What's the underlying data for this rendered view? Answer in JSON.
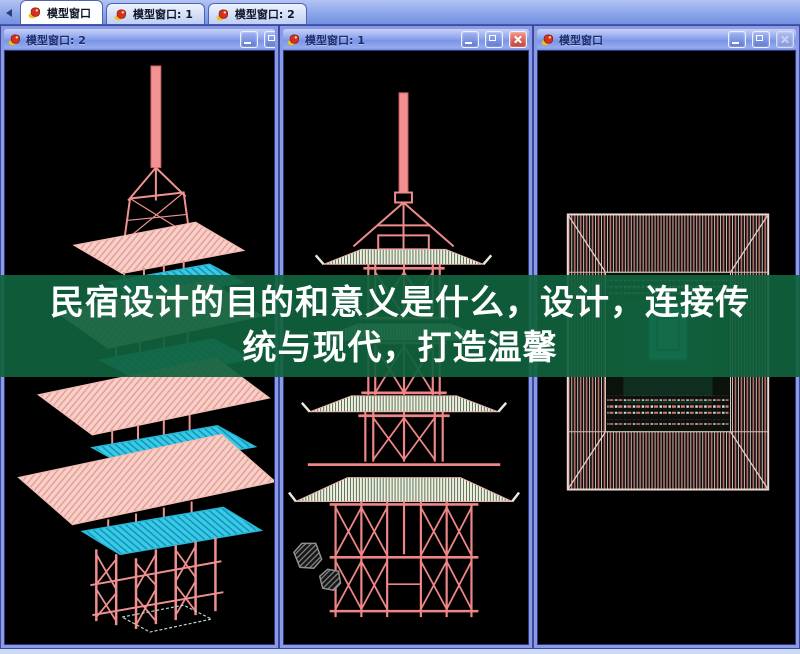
{
  "tab_bar": {
    "tabs": [
      {
        "label": "模型窗口",
        "active": true
      },
      {
        "label": "模型窗口: 1",
        "active": false
      },
      {
        "label": "模型窗口: 2",
        "active": false
      }
    ]
  },
  "windows": [
    {
      "title": "模型窗口: 2",
      "controls": [
        "minimize",
        "restore"
      ]
    },
    {
      "title": "模型窗口: 1",
      "controls": [
        "minimize",
        "maximize",
        "close"
      ]
    },
    {
      "title": "模型窗口",
      "controls": [
        "minimize",
        "maximize",
        "close-disabled"
      ]
    }
  ],
  "banner": {
    "line1": "民宿设计的目的和意义是什么，设计，连接传",
    "line2": "统与现代，打造温馨",
    "background": "#10623d",
    "text_color": "#ffffff"
  },
  "colors": {
    "titlebar_blue": "#7b94e6",
    "window_border": "#8a9ae4",
    "close_red": "#c43e30",
    "canvas_black": "#000000",
    "wireframe_pink": "#ef8f8f",
    "wireframe_cyan": "#39d0ea",
    "roof_fill": "#f6d0c9"
  }
}
